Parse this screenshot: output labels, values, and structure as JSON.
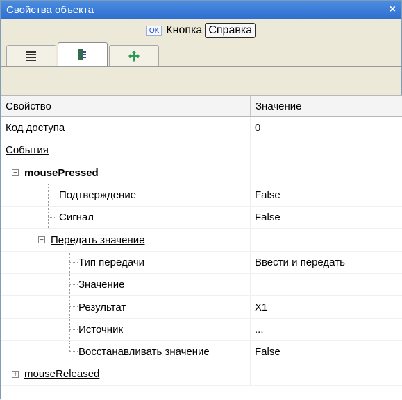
{
  "window": {
    "title": "Свойства объекта",
    "close_label": "×"
  },
  "object": {
    "ok_badge": "OK",
    "name": "Кнопка",
    "help_button": "Справка"
  },
  "tabs": [
    {
      "name": "properties-tab",
      "icon": "list-icon",
      "active": false
    },
    {
      "name": "events-tab",
      "icon": "event-icon",
      "active": true
    },
    {
      "name": "transfer-tab",
      "icon": "move-icon",
      "active": false
    }
  ],
  "grid": {
    "headers": {
      "property": "Свойство",
      "value": "Значение"
    },
    "rows": [
      {
        "name": "Код доступа",
        "value": "0"
      },
      {
        "name": "События",
        "value": ""
      },
      {
        "name": "mousePressed",
        "value": ""
      },
      {
        "name": "Подтверждение",
        "value": "False"
      },
      {
        "name": "Сигнал",
        "value": "False"
      },
      {
        "name": "Передать значение",
        "value": ""
      },
      {
        "name": "Тип передачи",
        "value": "Ввести и передать"
      },
      {
        "name": "Значение",
        "value": ""
      },
      {
        "name": "Результат",
        "value": "X1"
      },
      {
        "name": "Источник",
        "value": "..."
      },
      {
        "name": "Восстанавливать значение",
        "value": "False"
      },
      {
        "name": "mouseReleased",
        "value": ""
      }
    ]
  },
  "expanders": {
    "collapsed": "+",
    "expanded": "−"
  }
}
